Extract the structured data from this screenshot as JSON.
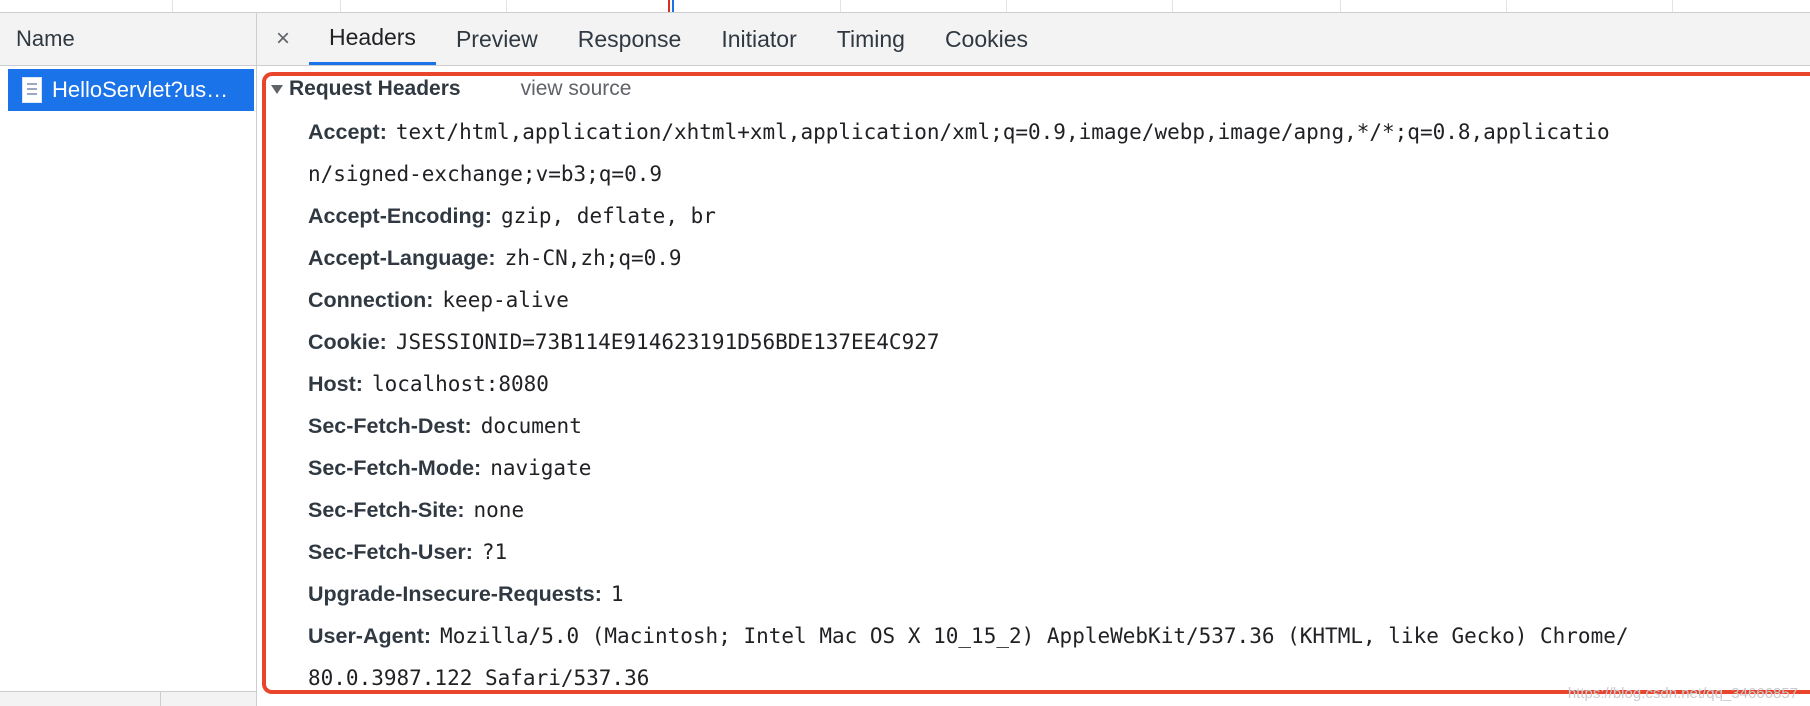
{
  "left_panel": {
    "header": "Name",
    "selected_request": "HelloServlet?us…"
  },
  "tabs": [
    {
      "label": "Headers",
      "active": true
    },
    {
      "label": "Preview",
      "active": false
    },
    {
      "label": "Response",
      "active": false
    },
    {
      "label": "Initiator",
      "active": false
    },
    {
      "label": "Timing",
      "active": false
    },
    {
      "label": "Cookies",
      "active": false
    }
  ],
  "close_glyph": "×",
  "section": {
    "title": "Request Headers",
    "view_source": "view source"
  },
  "headers": [
    {
      "key": "Accept:",
      "value": "text/html,application/xhtml+xml,application/xml;q=0.9,image/webp,image/apng,*/*;q=0.8,applicatio",
      "cont": "n/signed-exchange;v=b3;q=0.9"
    },
    {
      "key": "Accept-Encoding:",
      "value": "gzip, deflate, br"
    },
    {
      "key": "Accept-Language:",
      "value": "zh-CN,zh;q=0.9"
    },
    {
      "key": "Connection:",
      "value": "keep-alive"
    },
    {
      "key": "Cookie:",
      "value": "JSESSIONID=73B114E914623191D56BDE137EE4C927"
    },
    {
      "key": "Host:",
      "value": "localhost:8080"
    },
    {
      "key": "Sec-Fetch-Dest:",
      "value": "document"
    },
    {
      "key": "Sec-Fetch-Mode:",
      "value": "navigate"
    },
    {
      "key": "Sec-Fetch-Site:",
      "value": "none"
    },
    {
      "key": "Sec-Fetch-User:",
      "value": "?1"
    },
    {
      "key": "Upgrade-Insecure-Requests:",
      "value": "1"
    },
    {
      "key": "User-Agent:",
      "value": "Mozilla/5.0 (Macintosh; Intel Mac OS X 10_15_2) AppleWebKit/537.36 (KHTML, like Gecko) Chrome/",
      "cont": "80.0.3987.122 Safari/537.36"
    }
  ],
  "watermark": "https://blog.csdn.net/qq_34666857",
  "colors": {
    "accent": "#1a73e8",
    "highlight_box": "#e8452c"
  }
}
